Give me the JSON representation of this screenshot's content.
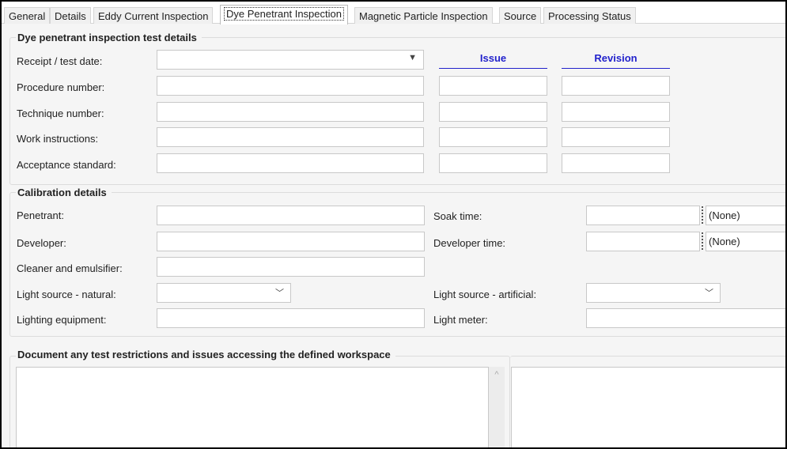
{
  "tabs": [
    "General",
    "Details",
    "Eddy Current Inspection",
    "Dye Penetrant Inspection",
    "Magnetic Particle Inspection",
    "Source",
    "Processing Status"
  ],
  "active_tab": "Dye Penetrant Inspection",
  "test_details": {
    "title": "Dye penetrant inspection test details",
    "issue_header": "Issue",
    "revision_header": "Revision",
    "labels": [
      "Receipt / test date:",
      "Procedure number:",
      "Technique number:",
      "Work instructions:",
      "Acceptance standard:"
    ]
  },
  "calibration": {
    "title": "Calibration details",
    "left_labels": [
      "Penetrant:",
      "Developer:",
      "Cleaner and emulsifier:",
      "Light source - natural:",
      "Lighting equipment:"
    ],
    "soak_time": "Soak time:",
    "developer_time": "Developer time:",
    "light_artificial": "Light source - artificial:",
    "light_meter": "Light meter:",
    "soak_unit": "(None)",
    "developer_unit": "(None)"
  },
  "restrictions": {
    "title": "Document any test restrictions and issues accessing the defined workspace"
  }
}
